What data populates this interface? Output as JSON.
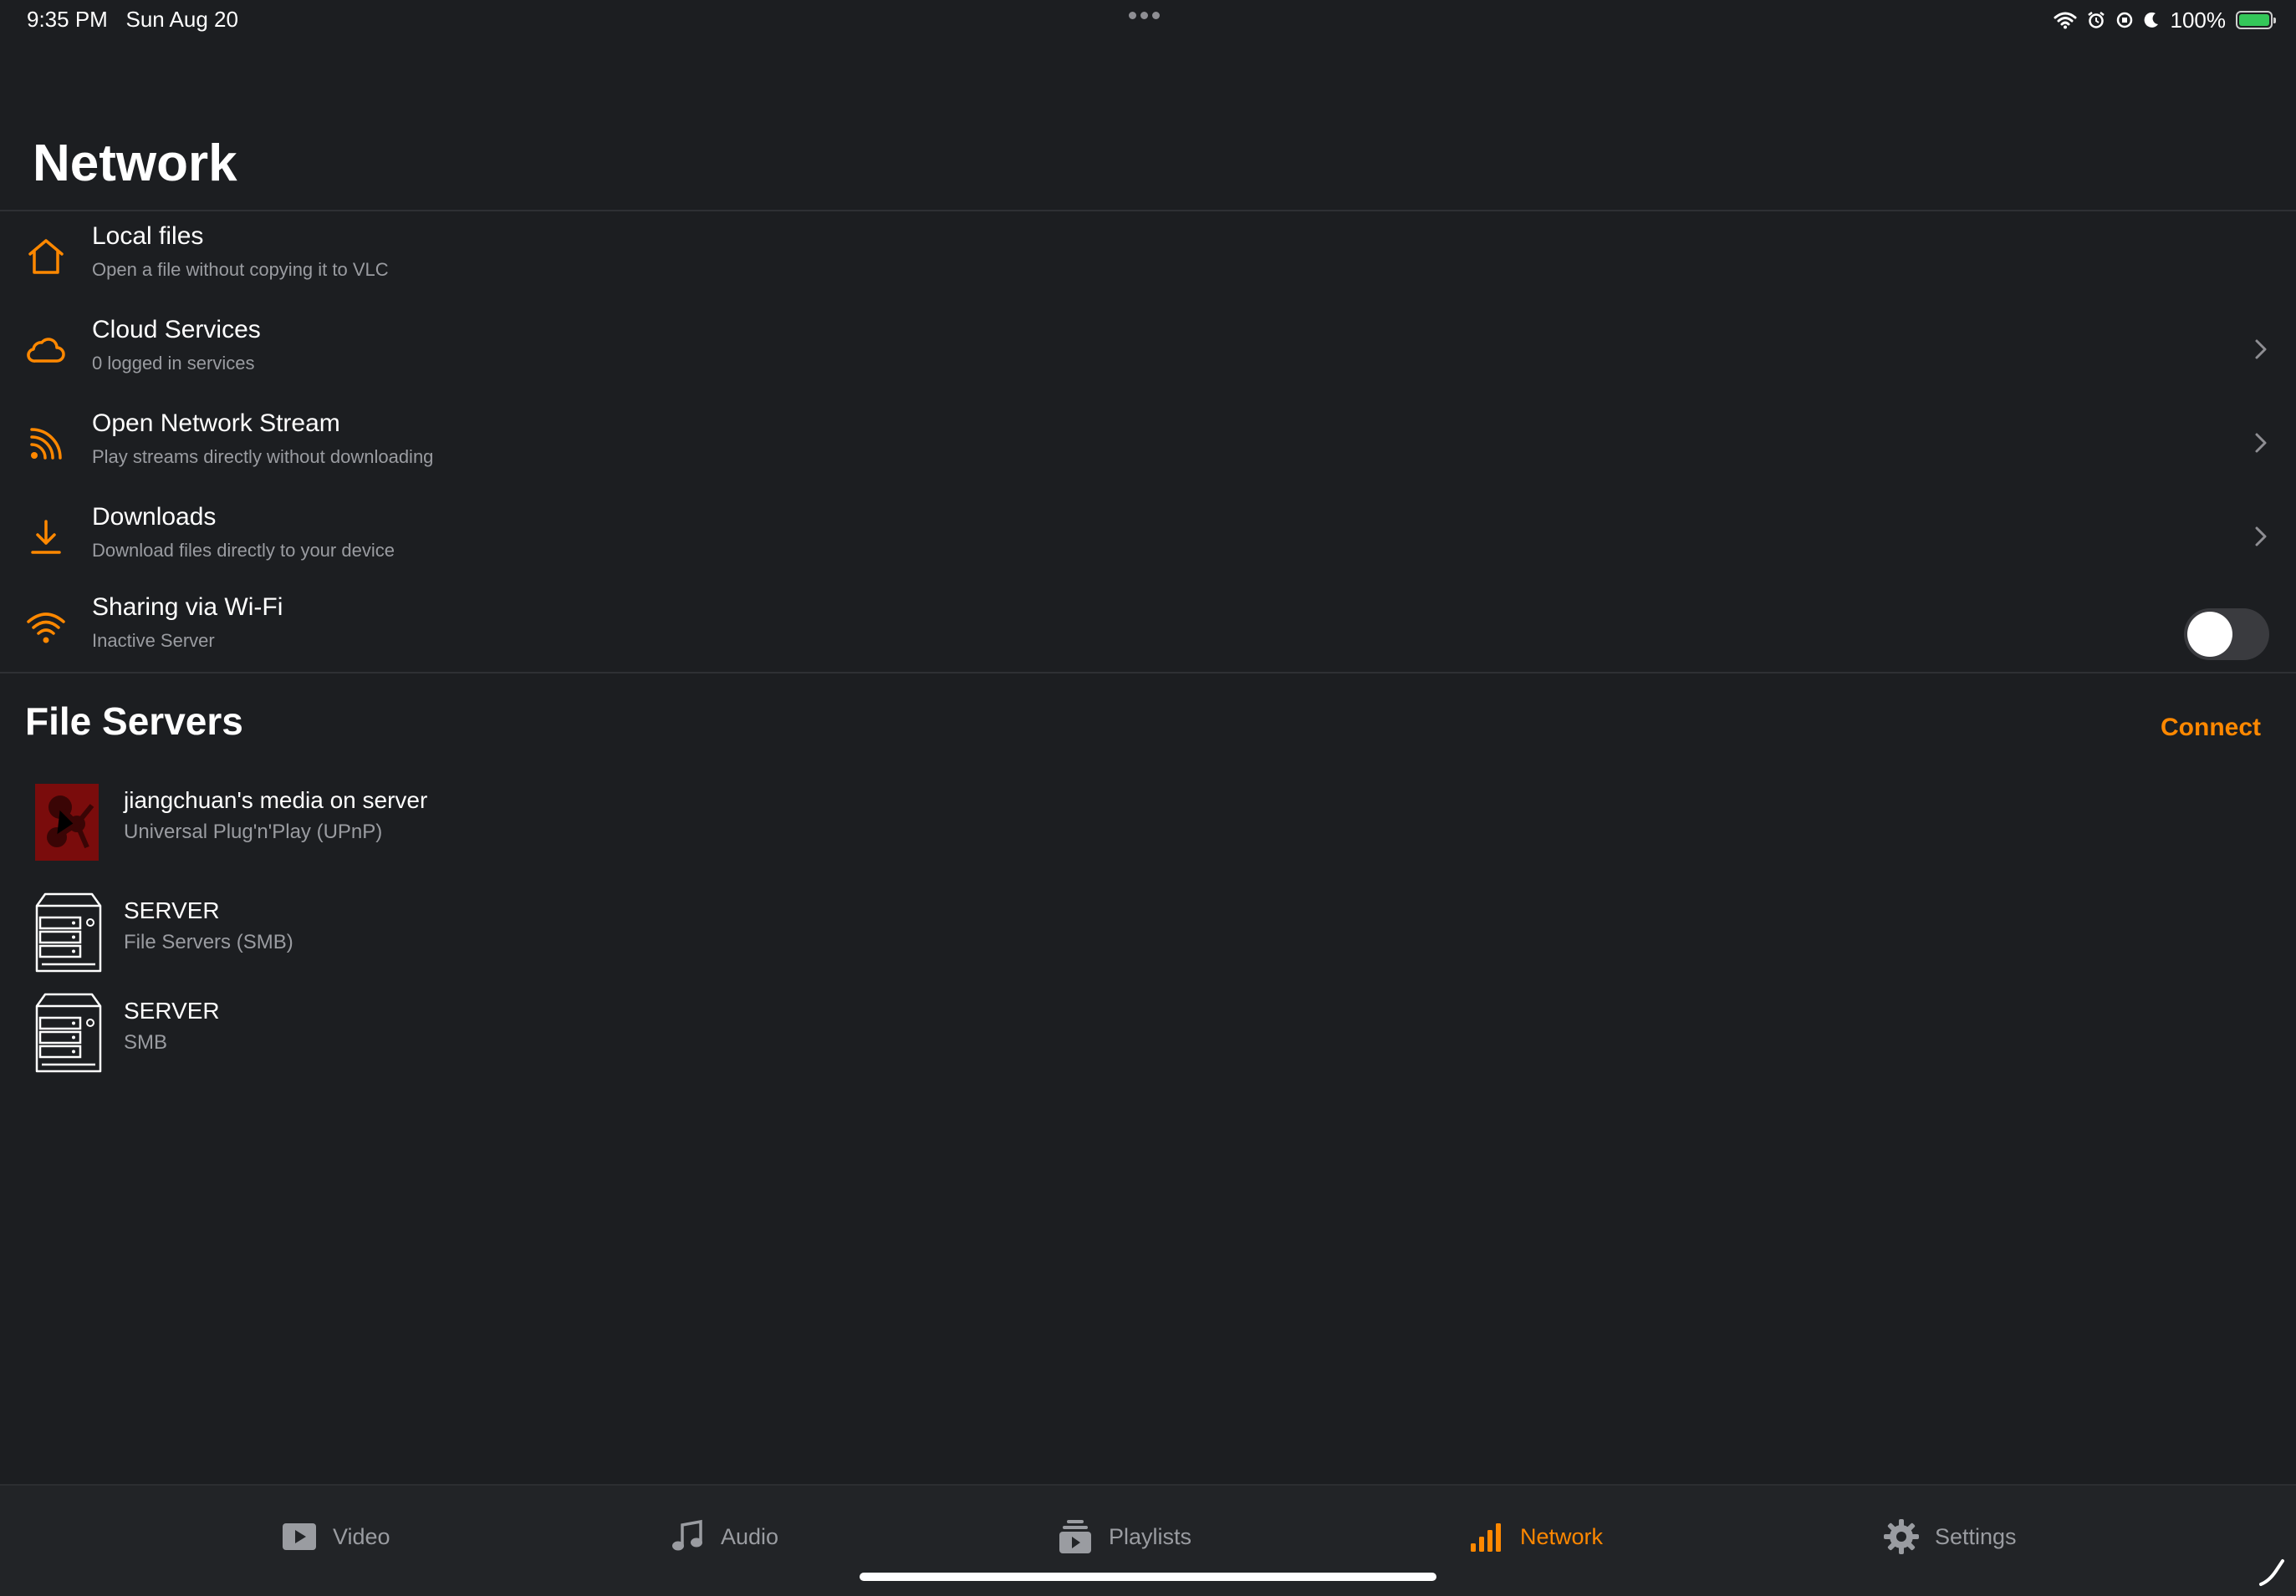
{
  "status_bar": {
    "time": "9:35 PM",
    "date": "Sun Aug 20",
    "battery": "100%"
  },
  "page_title": "Network",
  "menu": [
    {
      "title": "Local files",
      "subtitle": "Open a file without copying it to VLC",
      "icon": "home-icon"
    },
    {
      "title": "Cloud Services",
      "subtitle": "0 logged in services",
      "icon": "cloud-icon"
    },
    {
      "title": "Open Network Stream",
      "subtitle": "Play streams directly without downloading",
      "icon": "stream-icon"
    },
    {
      "title": "Downloads",
      "subtitle": "Download files directly to your device",
      "icon": "download-icon"
    },
    {
      "title": "Sharing via Wi-Fi",
      "subtitle": "Inactive Server",
      "icon": "wifi-icon",
      "toggle_on": false
    }
  ],
  "file_servers": {
    "title": "File Servers",
    "connect_label": "Connect",
    "items": [
      {
        "title": "jiangchuan's media on server",
        "subtitle": "Universal Plug'n'Play (UPnP)",
        "icon": "upnp-server-icon"
      },
      {
        "title": "SERVER",
        "subtitle": "File Servers (SMB)",
        "icon": "server-icon"
      },
      {
        "title": "SERVER",
        "subtitle": "SMB",
        "icon": "server-icon"
      }
    ]
  },
  "tabs": [
    {
      "label": "Video",
      "icon": "video-icon"
    },
    {
      "label": "Audio",
      "icon": "music-note-icon"
    },
    {
      "label": "Playlists",
      "icon": "playlists-icon"
    },
    {
      "label": "Network",
      "icon": "network-icon",
      "active": true
    },
    {
      "label": "Settings",
      "icon": "gear-icon"
    }
  ],
  "colors": {
    "accent": "#ff8800",
    "background": "#1c1e21",
    "battery": "#34c759"
  }
}
